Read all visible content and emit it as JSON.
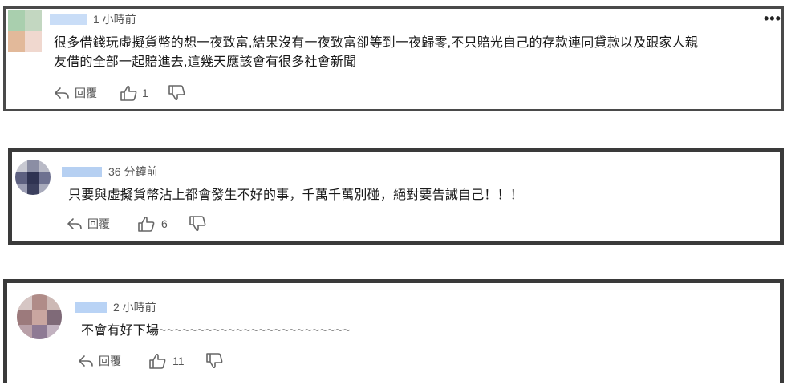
{
  "comments": [
    {
      "time": "1 小時前",
      "text_line1": "很多借錢玩虛擬貨幣的想一夜致富,結果沒有一夜致富卻等到一夜歸零,不只賠光自己的存款連同貸款以及跟家人親",
      "text_line2": "友借的全部一起賠進去,這幾天應該會有很多社會新聞",
      "reply_label": "回覆",
      "likes": "1",
      "more_label": "•••"
    },
    {
      "time": "36 分鐘前",
      "text": "只要與虛擬貨幣沾上都會發生不好的事，千萬千萬別碰，絕對要告誡自己！！！",
      "reply_label": "回覆",
      "likes": "6"
    },
    {
      "time": "2 小時前",
      "text": "不會有好下場~~~~~~~~~~~~~~~~~~~~~~~~~",
      "reply_label": "回覆",
      "likes": "11"
    }
  ],
  "icons": {
    "reply": "reply-arrow-icon",
    "like": "thumbs-up-icon",
    "dislike": "thumbs-down-icon",
    "more": "more-horizontal-icon"
  },
  "colors": {
    "name_blur": "#b9d3f5",
    "text": "#1a1a1a",
    "meta": "#555555"
  }
}
